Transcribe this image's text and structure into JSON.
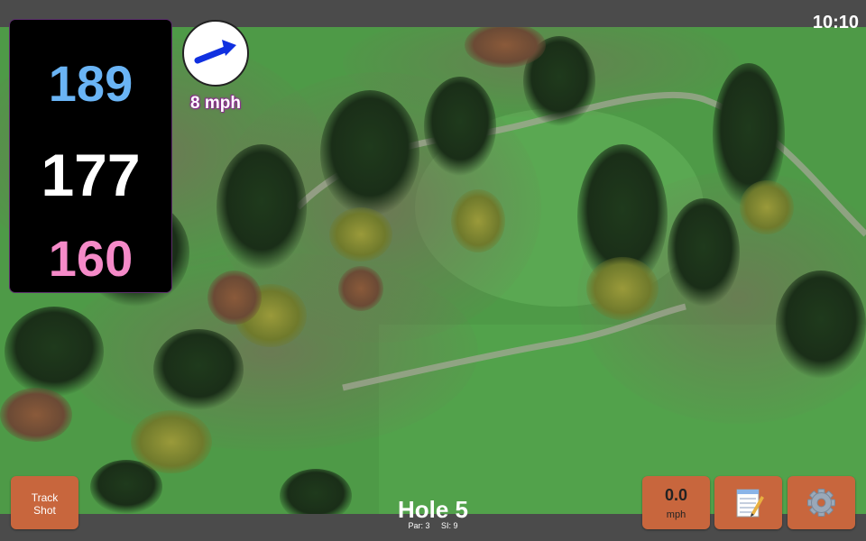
{
  "status": {
    "time": "10:10"
  },
  "distances": {
    "back": "189",
    "middle": "177",
    "front": "160"
  },
  "wind": {
    "speed_label": "8 mph",
    "icon": "wind-arrow-icon"
  },
  "hole": {
    "title": "Hole 5",
    "par_label": "Par: 3",
    "si_label": "SI: 9"
  },
  "buttons": {
    "track_line1": "Track",
    "track_line2": "Shot",
    "speed_value": "0.0",
    "speed_unit": "mph",
    "notes_icon": "notepad-icon",
    "settings_icon": "gear-icon"
  },
  "colors": {
    "back": "#6ab4f5",
    "middle": "#ffffff",
    "front": "#f58ac8",
    "button": "#c8663d",
    "wind_arrow": "#1030e0"
  }
}
